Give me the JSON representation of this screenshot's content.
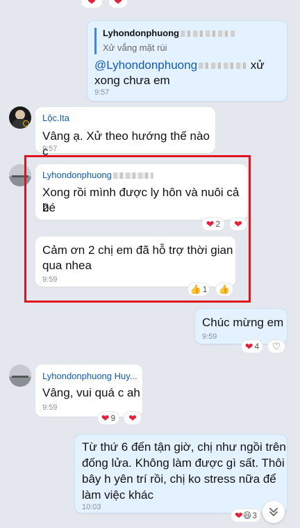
{
  "reply_message": {
    "quote_author": "Lyhondonphuong",
    "quote_text": "Xử vắng mặt rùi",
    "mention": "@Lyhondonphuong",
    "text_line1_end": "xử",
    "text_line2": "xong chưa em",
    "time": "9:57"
  },
  "loc_message": {
    "sender": "Lộc.Ita",
    "text": "Vâng ạ. Xử theo hướng thế nào c",
    "time": "9:57"
  },
  "highlight_group": {
    "sender": "Lyhondonphuong",
    "msg1_line1": "Xong rồi mình được ly hôn và nuôi cả 2",
    "msg1_line2": "bé",
    "msg1_heart_count": "2",
    "msg2_line1": "Cảm ơn 2 chị em đã hỗ trợ thời gian",
    "msg2_line2": "qua nhea",
    "msg2_time": "9:59",
    "msg2_like_count": "1"
  },
  "congrats_message": {
    "text": "Chúc mừng em",
    "time": "9:59",
    "heart_count": "4"
  },
  "vang_message": {
    "sender": "Lyhondonphuong Huy...",
    "text": "Vâng, vui quá c ah",
    "time": "9:59",
    "heart_count": "9"
  },
  "last_message": {
    "line1": "Từ thứ 6 đến tận giờ, chị như ngồi trên",
    "line2": "đống lửa. Không làm được gì sất. Thôi",
    "line3": "bây h yên trí rồi, chị ko stress nữa để",
    "line4": "làm việc khác",
    "time": "10:03",
    "reaction_count": "3"
  },
  "icons": {
    "heart": "heart-icon",
    "thumbs_up": "thumbs-up-icon",
    "scroll_down": "chevron-double-down-icon"
  },
  "colors": {
    "background": "#e4e8ee",
    "my_bubble": "#e4f1ff",
    "sender_name": "#0f5bb5",
    "heart": "#e3213b",
    "highlight_box": "#e0131c"
  }
}
